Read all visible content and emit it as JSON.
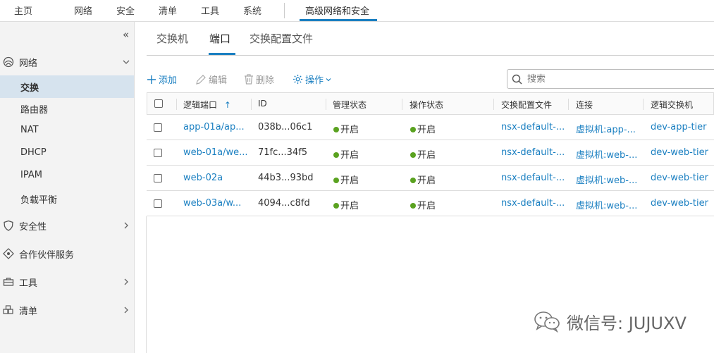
{
  "topnav": {
    "items": [
      "主页",
      "网络",
      "安全",
      "清单",
      "工具",
      "系统"
    ],
    "active": "高级网络和安全"
  },
  "sidebar": {
    "collapse_glyph": "«",
    "sections": [
      {
        "label": "网络",
        "icon": "network-icon",
        "expanded": true
      },
      {
        "label": "安全性",
        "icon": "shield-icon"
      },
      {
        "label": "合作伙伴服务",
        "icon": "partner-icon"
      },
      {
        "label": "工具",
        "icon": "toolbox-icon"
      },
      {
        "label": "清单",
        "icon": "inventory-icon"
      }
    ],
    "network_children": [
      "交换",
      "路由器",
      "NAT",
      "DHCP",
      "IPAM",
      "负载平衡"
    ],
    "selected": "交换"
  },
  "tabs": [
    "交换机",
    "端口",
    "交换配置文件"
  ],
  "active_tab": "端口",
  "toolbar": {
    "add": "添加",
    "edit": "编辑",
    "delete": "删除",
    "actions": "操作",
    "search_placeholder": "搜索"
  },
  "grid": {
    "columns": [
      "逻辑端口",
      "ID",
      "管理状态",
      "操作状态",
      "交换配置文件",
      "连接",
      "逻辑交换机"
    ],
    "sort_glyph": "↑",
    "rows": [
      {
        "port": "app-01a/ap...",
        "id": "038b...06c1",
        "admin": "开启",
        "oper": "开启",
        "profile": "nsx-default-...",
        "conn": "虚拟机:app-...",
        "ls": "dev-app-tier"
      },
      {
        "port": "web-01a/we...",
        "id": "71fc...34f5",
        "admin": "开启",
        "oper": "开启",
        "profile": "nsx-default-...",
        "conn": "虚拟机:web-...",
        "ls": "dev-web-tier"
      },
      {
        "port": "web-02a",
        "id": "44b3...93bd",
        "admin": "开启",
        "oper": "开启",
        "profile": "nsx-default-...",
        "conn": "虚拟机:web-...",
        "ls": "dev-web-tier"
      },
      {
        "port": "web-03a/w...",
        "id": "4094...c8fd",
        "admin": "开启",
        "oper": "开启",
        "profile": "nsx-default-...",
        "conn": "虚拟机:web-...",
        "ls": "dev-web-tier"
      }
    ]
  },
  "watermark": "微信号: JUJUXV",
  "colors": {
    "accent": "#1a7fc1",
    "status_on": "#5aa220",
    "selected_bg": "#d6e3ee"
  }
}
